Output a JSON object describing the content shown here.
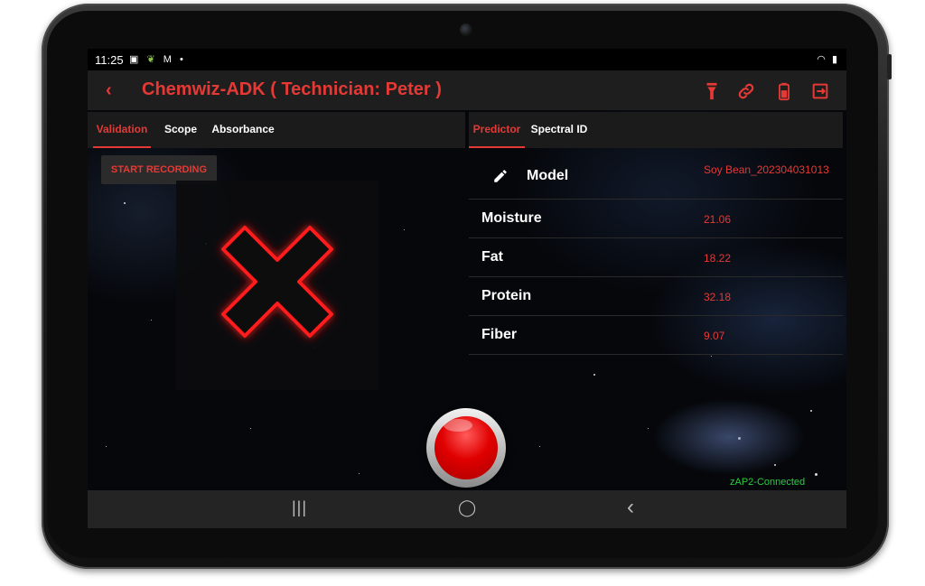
{
  "status_bar": {
    "time": "11:25",
    "notification_icons": [
      "image-icon",
      "leaf-icon",
      "gmail-icon",
      "dot-icon"
    ],
    "system_icons": [
      "wifi-icon",
      "battery-icon"
    ]
  },
  "app_bar": {
    "title": "Chemwiz-ADK ( Technician: Peter )",
    "actions": [
      "flashlight-icon",
      "link-icon",
      "battery-icon",
      "exit-icon"
    ]
  },
  "left_tabs": [
    {
      "label": "Validation",
      "active": true
    },
    {
      "label": "Scope",
      "active": false
    },
    {
      "label": "Absorbance",
      "active": false
    }
  ],
  "right_tabs": [
    {
      "label": "Predictor",
      "active": true
    },
    {
      "label": "Spectral ID",
      "active": false
    }
  ],
  "start_recording_label": "START RECORDING",
  "validation_status": "failed",
  "predictor": {
    "model_label": "Model",
    "model_value": "Soy Bean_202304031013",
    "rows": [
      {
        "label": "Moisture",
        "value": "21.06"
      },
      {
        "label": "Fat",
        "value": "18.22"
      },
      {
        "label": "Protein",
        "value": "32.18"
      },
      {
        "label": "Fiber",
        "value": "9.07"
      }
    ]
  },
  "connection_status": "zAP2-Connected",
  "nav_bar": {
    "recents_glyph": "|||",
    "home_glyph": "◯",
    "back_glyph": "‹"
  },
  "colors": {
    "accent": "#e53935",
    "connected": "#2ecc40",
    "appbar": "#1e1e1e"
  }
}
